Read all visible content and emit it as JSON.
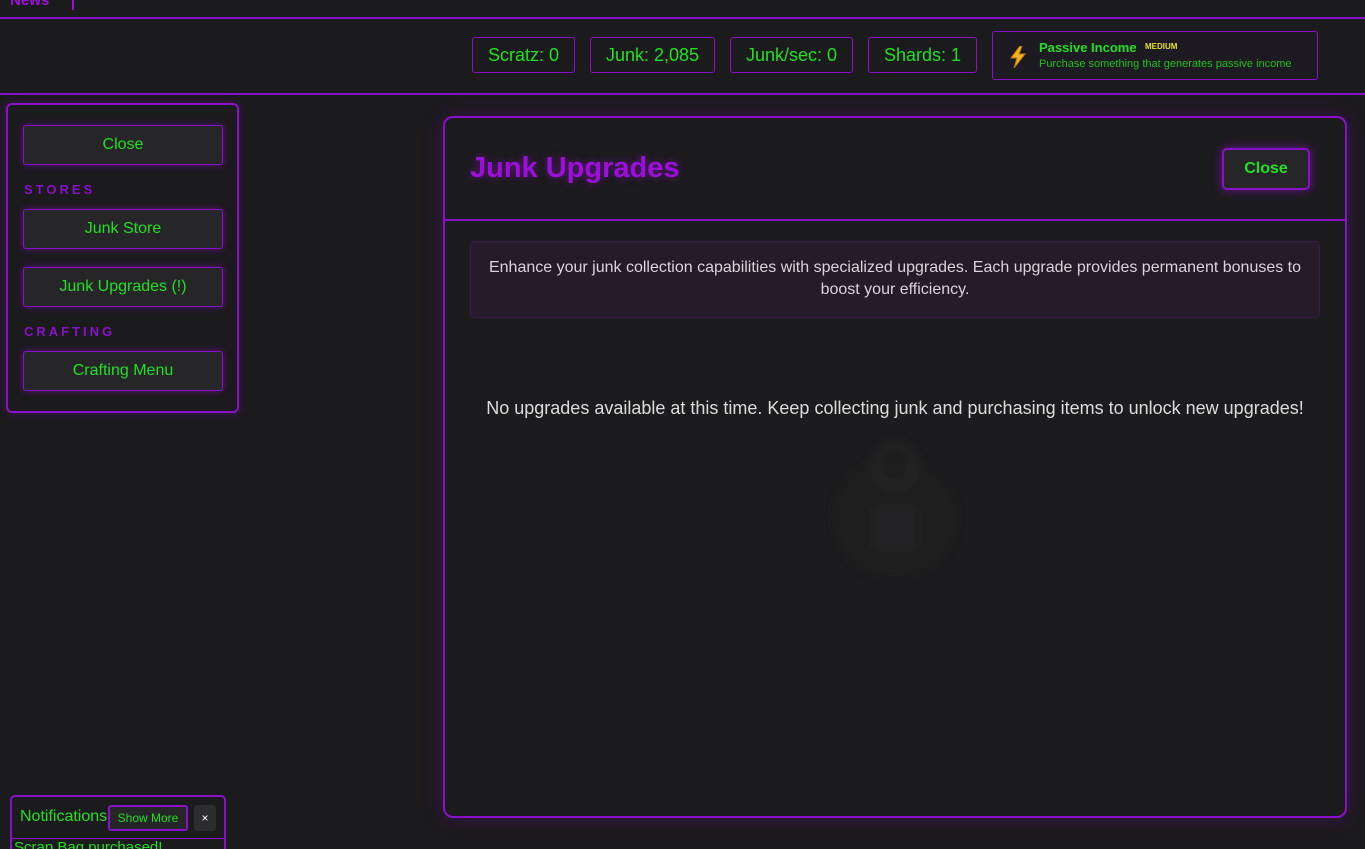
{
  "topnav": {
    "news_label": "News"
  },
  "stats": {
    "scratz": "Scratz: 0",
    "junk": "Junk: 2,085",
    "junk_per_sec": "Junk/sec: 0",
    "shards": "Shards: 1"
  },
  "passive_income": {
    "icon": "lightning-bolt-icon",
    "title": "Passive Income",
    "badge": "MEDIUM",
    "description": "Purchase something that generates passive income"
  },
  "sidebar": {
    "close_label": "Close",
    "stores_heading": "STORES",
    "junk_store_label": "Junk Store",
    "junk_upgrades_label": "Junk Upgrades (!)",
    "crafting_heading": "CRAFTING",
    "crafting_menu_label": "Crafting Menu"
  },
  "panel": {
    "title": "Junk Upgrades",
    "close_label": "Close",
    "intro": "Enhance your junk collection capabilities with specialized upgrades. Each upgrade provides permanent bonuses to boost your efficiency.",
    "empty_message": "No upgrades available at this time. Keep collecting junk and purchasing items to unlock new upgrades!"
  },
  "notifications": {
    "title": "Notifications",
    "show_more_label": "Show More",
    "close_label": "×",
    "message": "Scrap Bag purchased!"
  },
  "colors": {
    "accent_purple": "#8a10c9",
    "text_green": "#21e021",
    "background": "#1b1a1c",
    "badge_yellow": "#e8e020"
  }
}
